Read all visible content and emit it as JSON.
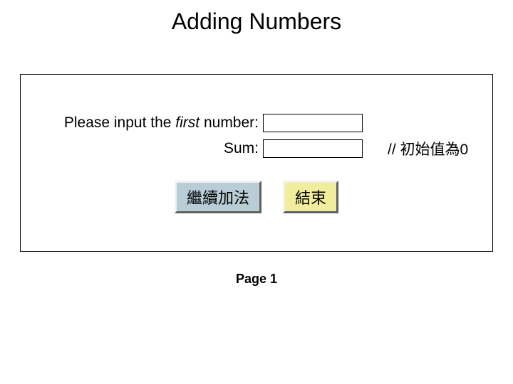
{
  "title": "Adding Numbers",
  "panel": {
    "prompt_prefix": "Please input the ",
    "prompt_italic": "first",
    "prompt_suffix": " number:",
    "sum_label": "Sum:",
    "annotation": "// 初始值為0",
    "input_number_value": "",
    "sum_value": ""
  },
  "buttons": {
    "continue_label": "繼續加法",
    "end_label": "結束"
  },
  "footer": {
    "page_label": "Page 1"
  }
}
